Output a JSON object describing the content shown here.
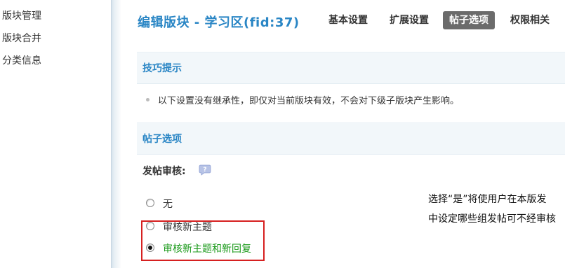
{
  "sidebar": {
    "items": [
      {
        "label": "版块管理"
      },
      {
        "label": "版块合并"
      },
      {
        "label": "分类信息"
      }
    ]
  },
  "header": {
    "title": "编辑版块 - 学习区(fid:37)",
    "tabs": [
      {
        "label": "基本设置",
        "active": false
      },
      {
        "label": "扩展设置",
        "active": false
      },
      {
        "label": "帖子选项",
        "active": true
      },
      {
        "label": "权限相关",
        "active": false
      }
    ]
  },
  "tips": {
    "title": "技巧提示",
    "text": "以下设置没有继承性，即仅对当前版块有效，不会对下级子版块产生影响。"
  },
  "options_section": {
    "title": "帖子选项"
  },
  "moderation": {
    "label": "发帖审核:",
    "options": [
      {
        "label": "无",
        "checked": false
      },
      {
        "label": "审核新主题",
        "checked": false
      },
      {
        "label": "审核新主题和新回复",
        "checked": true
      }
    ],
    "description_line1": "选择“是”将使用户在本版发",
    "description_line2": "中设定哪些组发帖可不经审核"
  },
  "colors": {
    "accent": "#2a86c5",
    "active_tab_bg": "#6b6b6b",
    "selected_option": "#1a9a1a",
    "highlight_border": "#d62020"
  }
}
